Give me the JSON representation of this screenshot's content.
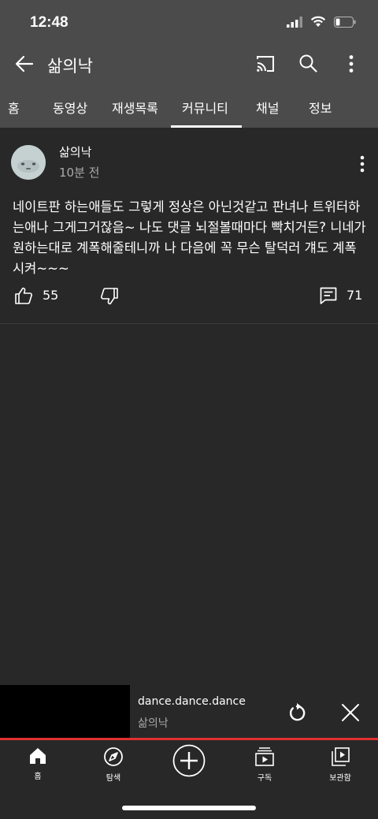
{
  "status_bar": {
    "time": "12:48"
  },
  "header": {
    "title": "삶의낙"
  },
  "tabs": [
    {
      "label": "홈"
    },
    {
      "label": "동영상"
    },
    {
      "label": "재생목록"
    },
    {
      "label": "커뮤니티"
    },
    {
      "label": "채널"
    },
    {
      "label": "정보"
    }
  ],
  "active_tab": "커뮤니티",
  "post": {
    "author": "삶의낙",
    "time": "10분 전",
    "body": "네이트판 하는애들도 그렇게 정상은 아닌것같고 판녀나 트위터하는애나 그게그거잖음~ 나도 댓글 뇌절볼때마다 빡치거든? 니네가 원하는대로 계폭해줄테니까 나 다음에 꼭 무슨 탈덕러 걔도 계폭시켜~~~",
    "likes": "55",
    "comments": "71"
  },
  "mini_player": {
    "title": "dance.dance.dance",
    "channel": "삶의낙",
    "progress_fraction": 1.0,
    "progress_color": "#e13030"
  },
  "bottom_nav": {
    "home": "홈",
    "explore": "탐색",
    "subscriptions": "구독",
    "library": "보관함"
  },
  "colors": {
    "background": "#282828",
    "bar": "#4b4b4b",
    "secondary_text": "#aaaaaa"
  }
}
